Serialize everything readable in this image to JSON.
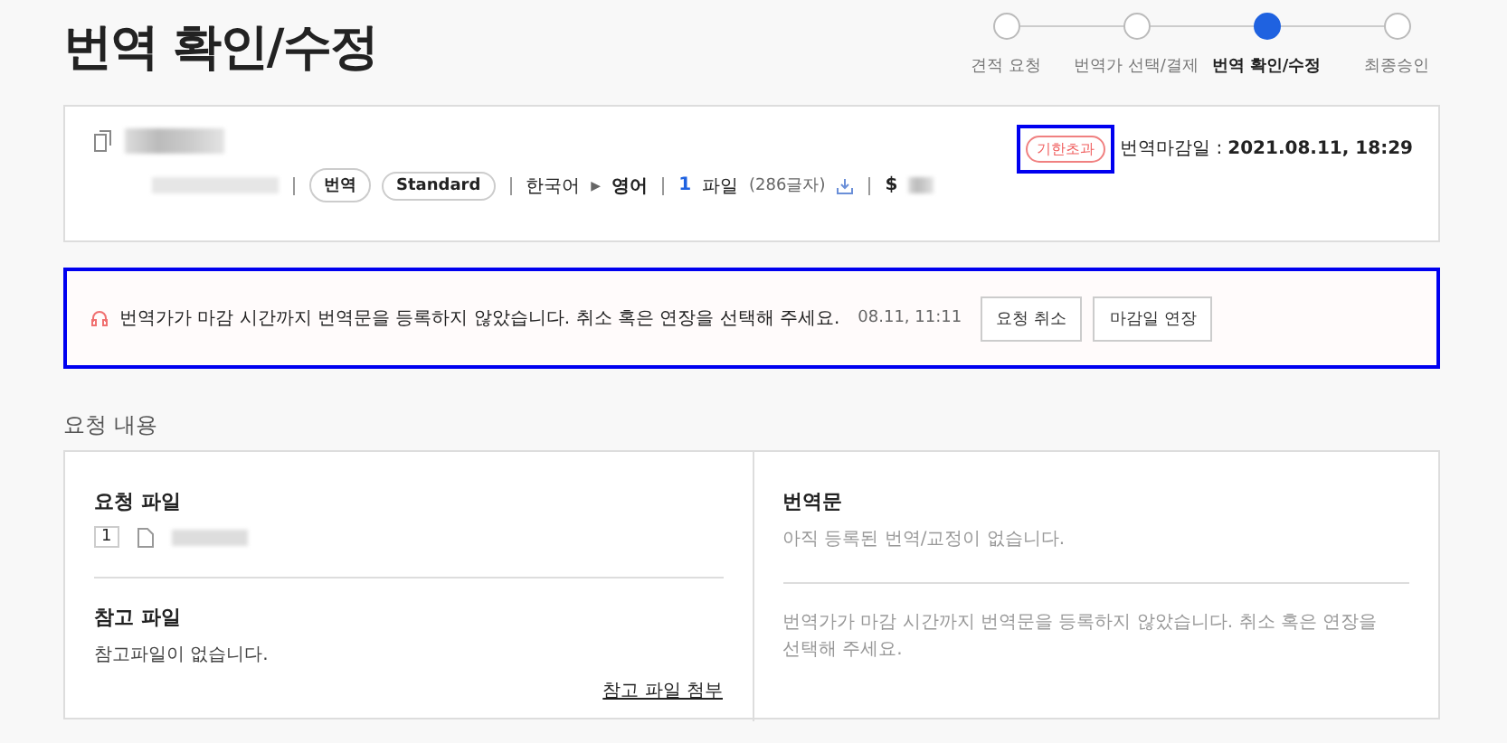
{
  "page_title": "번역 확인/수정",
  "steps": [
    {
      "label": "견적 요청",
      "selected": false
    },
    {
      "label": "번역가 선택/결제",
      "selected": false
    },
    {
      "label": "번역 확인/수정",
      "selected": true
    },
    {
      "label": "최종승인",
      "selected": false
    }
  ],
  "request": {
    "tags": [
      "번역",
      "Standard"
    ],
    "source_language": "한국어",
    "arrow": "▶",
    "target_language": "영어",
    "file_count": "1",
    "file_label": "파일",
    "char_count": "(286글자)",
    "currency": "$",
    "status_badge": {
      "label": "기한초과",
      "highlighted": true
    },
    "deadline_label": "번역마감일 :",
    "deadline": "2021.08.11, 18:29"
  },
  "alert": {
    "highlighted": true,
    "message": "번역가가 마감 시간까지 번역문을 등록하지 않았습니다. 취소 혹은 연장을 선택해 주세요.",
    "time": "08.11, 11:11",
    "buttons": [
      "요청 취소",
      "마감일 연장"
    ]
  },
  "section_title": "요청 내용",
  "request_files": {
    "title": "요청 파일",
    "files": [
      {
        "index": "1"
      }
    ]
  },
  "reference_files": {
    "title": "참고 파일",
    "empty_text": "참고파일이 없습니다.",
    "attach_link": "참고 파일 첨부"
  },
  "translation": {
    "title": "번역문",
    "empty_text": "아직 등록된 번역/교정이 없습니다.",
    "notice": "번역가가 마감 시간까지 번역문을 등록하지 않았습니다. 취소 혹은 연장을 선택해 주세요."
  }
}
